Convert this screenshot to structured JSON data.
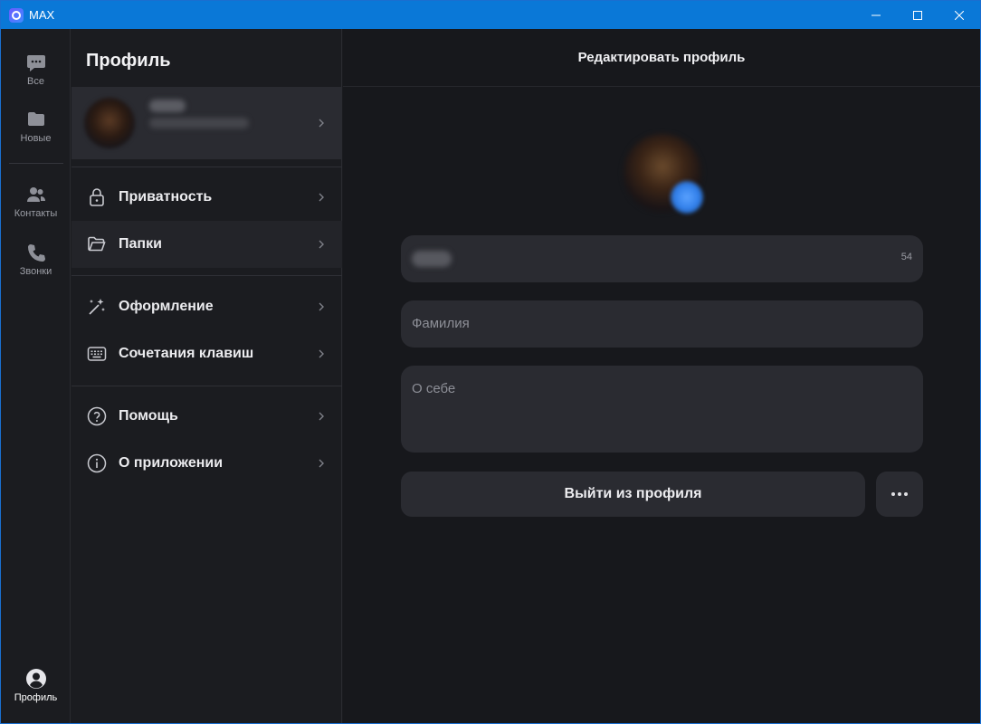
{
  "window": {
    "title": "MAX",
    "controls": [
      "minimize-icon",
      "maximize-icon",
      "close-icon"
    ]
  },
  "rail": {
    "items": [
      {
        "label": "Все",
        "icon": "chat-bubble-icon"
      },
      {
        "label": "Новые",
        "icon": "folder-icon"
      },
      {
        "label": "Контакты",
        "icon": "contacts-icon"
      },
      {
        "label": "Звонки",
        "icon": "phone-icon"
      }
    ],
    "profile": {
      "label": "Профиль",
      "icon": "profile-avatar-icon"
    }
  },
  "menu": {
    "title": "Профиль",
    "groups": [
      [
        {
          "label": "Приватность",
          "icon": "lock-icon"
        },
        {
          "label": "Папки",
          "icon": "folder-open-icon"
        }
      ],
      [
        {
          "label": "Оформление",
          "icon": "magic-wand-icon"
        },
        {
          "label": "Сочетания клавиш",
          "icon": "keyboard-icon"
        }
      ],
      [
        {
          "label": "Помощь",
          "icon": "help-circle-icon"
        },
        {
          "label": "О приложении",
          "icon": "info-circle-icon"
        }
      ]
    ]
  },
  "main": {
    "header_title": "Редактировать профиль",
    "name_counter": "54",
    "surname_placeholder": "Фамилия",
    "about_placeholder": "О себе",
    "logout_label": "Выйти из профиля",
    "more_label": "•••"
  },
  "colors": {
    "titlebar": "#0a78d7",
    "background": "#17181c",
    "panel": "#1b1c20",
    "field": "#2a2b31",
    "accent": "#2f7de8"
  }
}
